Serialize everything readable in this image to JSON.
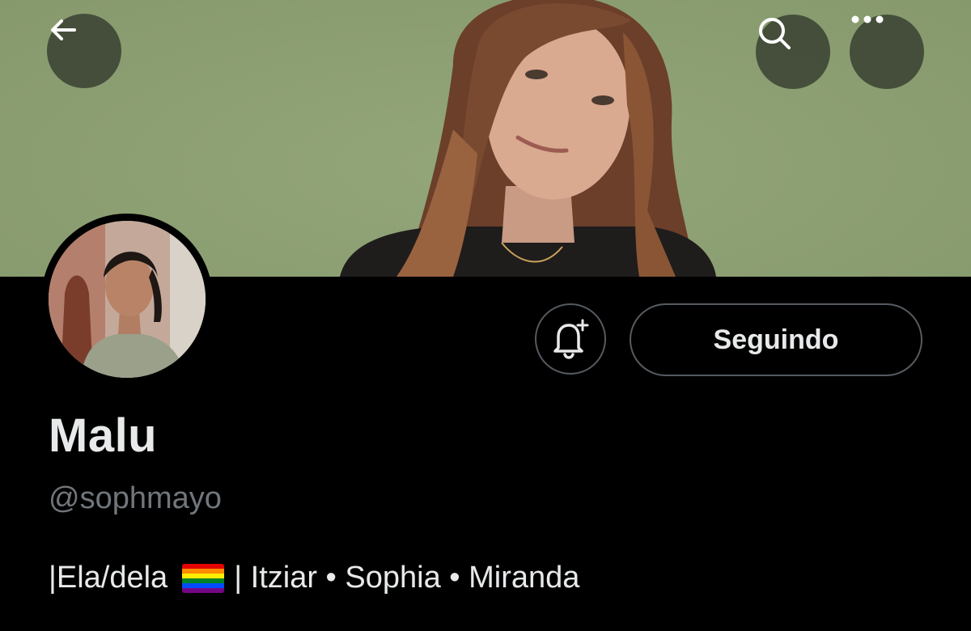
{
  "header": {
    "back_icon": "arrow-left-icon",
    "search_icon": "search-icon",
    "more_icon": "more-horizontal-icon",
    "banner_bg": "#8c9f73"
  },
  "profile": {
    "display_name": "Malu",
    "handle": "@sophmayo",
    "bio_prefix": "|Ela/dela",
    "bio_suffix": "| Itziar • Sophia • Miranda",
    "bio_flag": "rainbow-flag-emoji"
  },
  "actions": {
    "notify_icon": "bell-plus-icon",
    "follow_label": "Seguindo"
  },
  "colors": {
    "background": "#000000",
    "primary_text": "#e7e9ea",
    "secondary_text": "#71767b",
    "button_border": "#555b61"
  }
}
